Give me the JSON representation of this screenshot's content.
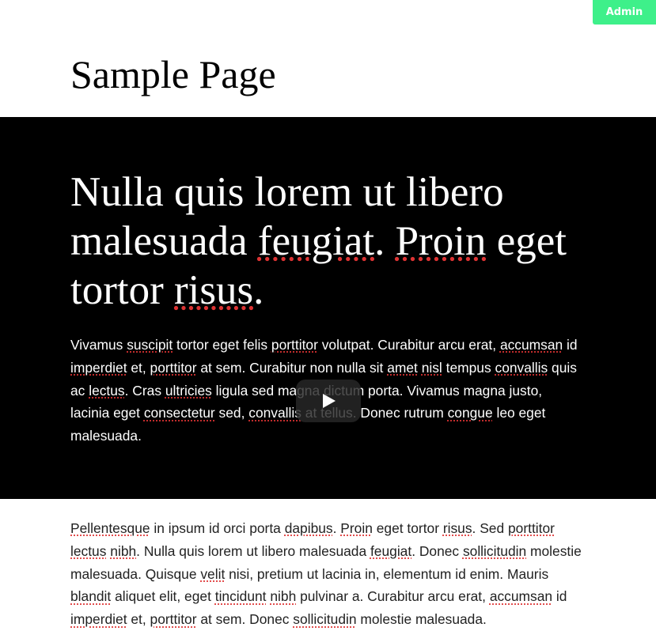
{
  "admin": {
    "label": "Admin",
    "color": "#3ef08a"
  },
  "page": {
    "title": "Sample Page"
  },
  "hero": {
    "heading": [
      "Nulla quis lorem ut libero malesuada ",
      "feugiat",
      ". ",
      "Proin",
      " eget tortor ",
      "risus",
      "."
    ],
    "paragraph": [
      "Vivamus ",
      "suscipit",
      " tortor eget felis ",
      "porttitor",
      " volutpat. Curabitur arcu erat, ",
      "accumsan",
      " id ",
      "imperdiet",
      " et, ",
      "porttitor",
      " at sem. Curabitur non nulla sit ",
      "amet",
      " ",
      "nisl",
      " tempus ",
      "convallis",
      " quis ac ",
      "lectus",
      ". Cras ",
      "ultricies",
      " ligula sed magna dictum porta. Vivamus magna justo, lacinia eget ",
      "consectetur",
      " sed, ",
      "convallis",
      " at tellus. Donec rutrum ",
      "congue",
      " leo eget malesuada."
    ],
    "play_icon": "play-icon"
  },
  "body": {
    "paragraph": [
      "Pellentesque",
      " in ipsum id orci porta ",
      "dapibus",
      ". ",
      "Proin",
      " eget tortor ",
      "risus",
      ". Sed ",
      "porttitor",
      " ",
      "lectus",
      " ",
      "nibh",
      ". Nulla quis lorem ut libero malesuada ",
      "feugiat",
      ". Donec ",
      "sollicitudin",
      " molestie malesuada. Quisque ",
      "velit",
      " nisi, pretium ut lacinia in, elementum id enim. Mauris ",
      "blandit",
      " aliquet elit, eget ",
      "tincidunt",
      " ",
      "nibh",
      " pulvinar a. Curabitur arcu erat, ",
      "accumsan",
      " id ",
      "imperdiet",
      " et, ",
      "porttitor",
      " at sem. Donec ",
      "sollicitudin",
      " molestie malesuada."
    ]
  }
}
